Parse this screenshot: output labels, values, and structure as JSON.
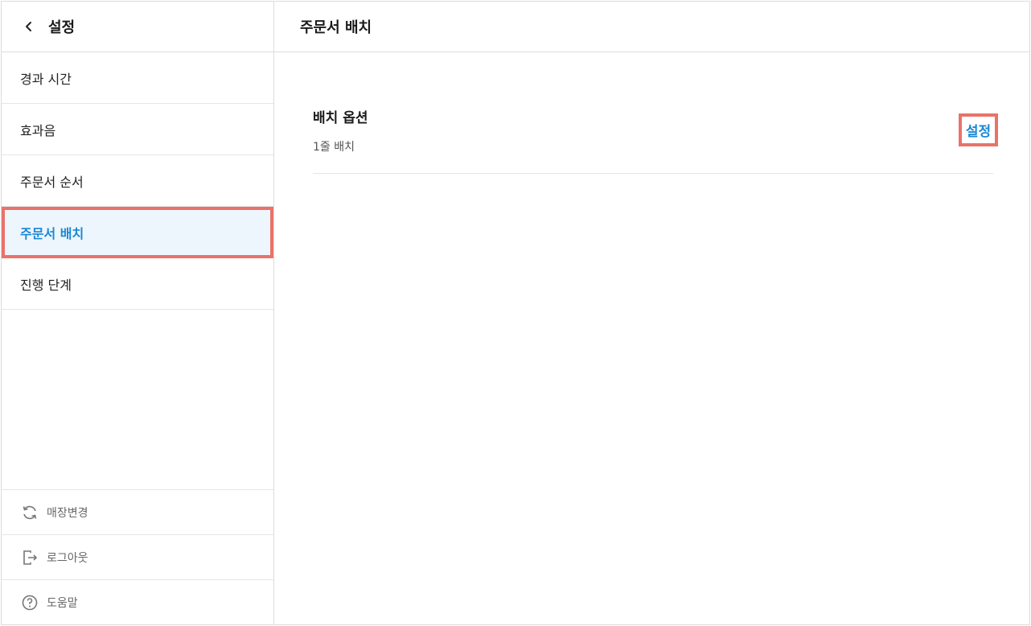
{
  "sidebar": {
    "back_icon": "chevron-left-icon",
    "title": "설정",
    "items": [
      {
        "label": "경과 시간"
      },
      {
        "label": "효과음"
      },
      {
        "label": "주문서 순서"
      },
      {
        "label": "주문서 배치"
      },
      {
        "label": "진행 단계"
      }
    ],
    "active_index": 3,
    "bottom": [
      {
        "label": "매장변경",
        "icon": "refresh-icon"
      },
      {
        "label": "로그아웃",
        "icon": "logout-icon"
      },
      {
        "label": "도움말",
        "icon": "help-icon"
      }
    ]
  },
  "main": {
    "title": "주문서 배치",
    "option": {
      "title": "배치 옵션",
      "value": "1줄 배치",
      "action_label": "설정"
    }
  },
  "colors": {
    "accent": "#1a88d6",
    "highlight_border": "#e8736a",
    "active_bg": "#eef6fd"
  }
}
